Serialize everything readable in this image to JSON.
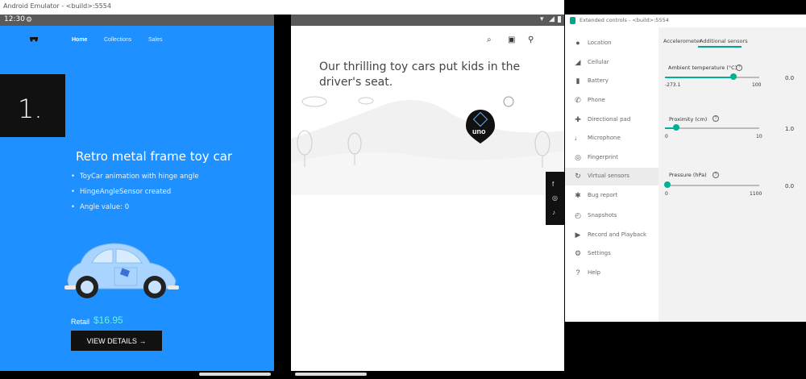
{
  "emulator": {
    "title": "Android Emulator - <build>:5554"
  },
  "status": {
    "time": "12:30"
  },
  "left": {
    "nav": [
      "Home",
      "Collections",
      "Sales"
    ],
    "number": "1.",
    "title": "Retro metal frame toy car",
    "bullets": [
      "ToyCar animation with hinge angle",
      "HingeAngleSensor created",
      "Angle value: 0"
    ],
    "retail_label": "Retail",
    "price": "$16.95",
    "button": "VIEW DETAILS →"
  },
  "right": {
    "headline": "Our thrilling toy cars put kids in the driver's seat.",
    "logo_text": "uno"
  },
  "extended": {
    "title": "Extended controls - <build>:5554",
    "sidebar": [
      {
        "label": "Location",
        "icon": "location-pin-icon"
      },
      {
        "label": "Cellular",
        "icon": "signal-icon"
      },
      {
        "label": "Battery",
        "icon": "battery-icon"
      },
      {
        "label": "Phone",
        "icon": "phone-icon"
      },
      {
        "label": "Directional pad",
        "icon": "dpad-icon"
      },
      {
        "label": "Microphone",
        "icon": "microphone-icon"
      },
      {
        "label": "Fingerprint",
        "icon": "fingerprint-icon"
      },
      {
        "label": "Virtual sensors",
        "icon": "rotate-icon"
      },
      {
        "label": "Bug report",
        "icon": "bug-icon"
      },
      {
        "label": "Snapshots",
        "icon": "history-icon"
      },
      {
        "label": "Record and Playback",
        "icon": "video-icon"
      },
      {
        "label": "Settings",
        "icon": "gear-icon"
      },
      {
        "label": "Help",
        "icon": "help-icon"
      }
    ],
    "tabs": [
      "Accelerometer",
      "Additional sensors"
    ],
    "sensors": [
      {
        "label": "Ambient temperature (°C)",
        "min": "-273.1",
        "max": "100",
        "value": "0.0",
        "fraction": 0.73
      },
      {
        "label": "Proximity (cm)",
        "min": "0",
        "max": "10",
        "value": "1.0",
        "fraction": 0.1
      },
      {
        "label": "Pressure (hPa)",
        "min": "0",
        "max": "1100",
        "value": "0.0",
        "fraction": 0.0
      }
    ]
  },
  "colors": {
    "left_bg": "#1e90ff",
    "accent": "#00b195",
    "price": "#6ff0d8"
  }
}
